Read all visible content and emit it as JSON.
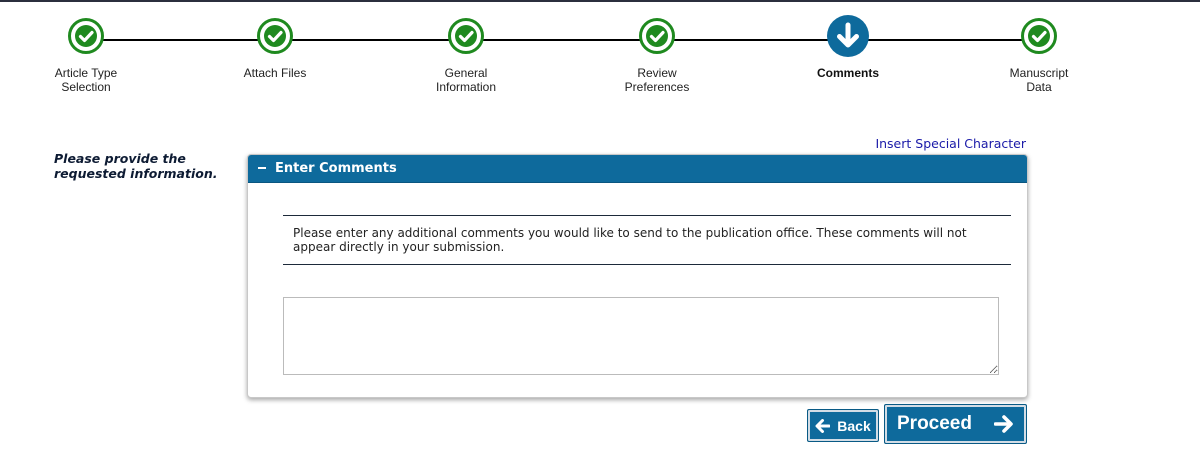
{
  "steps": [
    {
      "label": "Article Type\nSelection",
      "status": "complete"
    },
    {
      "label": "Attach Files",
      "status": "complete"
    },
    {
      "label": "General\nInformation",
      "status": "complete"
    },
    {
      "label": "Review\nPreferences",
      "status": "complete"
    },
    {
      "label": "Comments",
      "status": "current"
    },
    {
      "label": "Manuscript\nData",
      "status": "complete"
    }
  ],
  "instructions": "Please provide the requested information.",
  "special_char_link": "Insert Special Character",
  "panel": {
    "title": "Enter Comments",
    "note": "Please enter any additional comments you would like to send to the publication office. These comments will not appear directly in your submission.",
    "comment_value": ""
  },
  "buttons": {
    "back": "Back",
    "proceed": "Proceed"
  },
  "colors": {
    "complete_green": "#1f8a1f",
    "current_blue": "#0e6a9c",
    "header_blue": "#0e6a9c"
  },
  "icons": {
    "complete": "check-circle-icon",
    "current": "arrow-down-circle-icon",
    "back": "arrow-left-icon",
    "proceed": "arrow-right-icon"
  }
}
